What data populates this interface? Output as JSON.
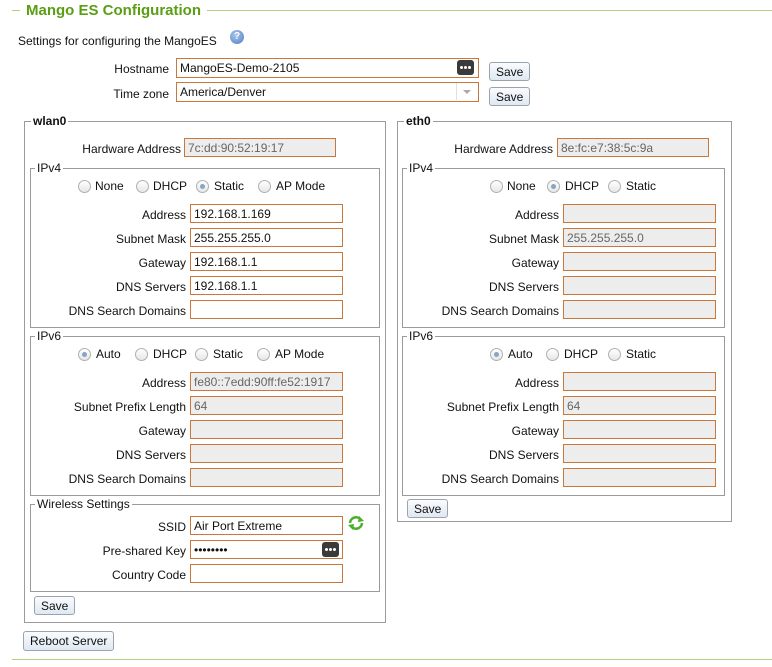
{
  "header": {
    "title": "Mango ES Configuration",
    "subtitle": "Settings for configuring the MangoES",
    "help_glyph": "?"
  },
  "hostname": {
    "label": "Hostname",
    "value": "MangoES-Demo-2105",
    "save_label": "Save"
  },
  "timezone": {
    "label": "Time zone",
    "value": "America/Denver",
    "save_label": "Save"
  },
  "wlan0": {
    "title": "wlan0",
    "hw_label": "Hardware Address",
    "hw_value": "7c:dd:90:52:19:17",
    "ipv4": {
      "legend": "IPv4",
      "modes": [
        "None",
        "DHCP",
        "Static",
        "AP Mode"
      ],
      "selected": "Static",
      "address_label": "Address",
      "address": "192.168.1.169",
      "subnet_label": "Subnet Mask",
      "subnet": "255.255.255.0",
      "gateway_label": "Gateway",
      "gateway": "192.168.1.1",
      "dns_label": "DNS Servers",
      "dns": "192.168.1.1",
      "search_label": "DNS Search Domains",
      "search": ""
    },
    "ipv6": {
      "legend": "IPv6",
      "modes": [
        "Auto",
        "DHCP",
        "Static",
        "AP Mode"
      ],
      "selected": "Auto",
      "address_label": "Address",
      "address": "fe80::7edd:90ff:fe52:1917",
      "prefix_label": "Subnet Prefix Length",
      "prefix": "64",
      "gateway_label": "Gateway",
      "gateway": "",
      "dns_label": "DNS Servers",
      "dns": "",
      "search_label": "DNS Search Domains",
      "search": ""
    },
    "wireless": {
      "legend": "Wireless Settings",
      "ssid_label": "SSID",
      "ssid": "Air Port Extreme",
      "psk_label": "Pre-shared Key",
      "psk": "••••••••",
      "country_label": "Country Code",
      "country": ""
    },
    "save_label": "Save"
  },
  "eth0": {
    "title": "eth0",
    "hw_label": "Hardware Address",
    "hw_value": "8e:fc:e7:38:5c:9a",
    "ipv4": {
      "legend": "IPv4",
      "modes": [
        "None",
        "DHCP",
        "Static"
      ],
      "selected": "DHCP",
      "address_label": "Address",
      "address": "",
      "subnet_label": "Subnet Mask",
      "subnet": "255.255.255.0",
      "gateway_label": "Gateway",
      "gateway": "",
      "dns_label": "DNS Servers",
      "dns": "",
      "search_label": "DNS Search Domains",
      "search": ""
    },
    "ipv6": {
      "legend": "IPv6",
      "modes": [
        "Auto",
        "DHCP",
        "Static"
      ],
      "selected": "Auto",
      "address_label": "Address",
      "address": "",
      "prefix_label": "Subnet Prefix Length",
      "prefix": "64",
      "gateway_label": "Gateway",
      "gateway": "",
      "dns_label": "DNS Servers",
      "dns": "",
      "search_label": "DNS Search Domains",
      "search": ""
    },
    "save_label": "Save"
  },
  "reboot_label": "Reboot Server",
  "colors": {
    "title_green": "#5a9e14",
    "input_border": "#c8783a",
    "readonly_bg": "#ededed"
  }
}
